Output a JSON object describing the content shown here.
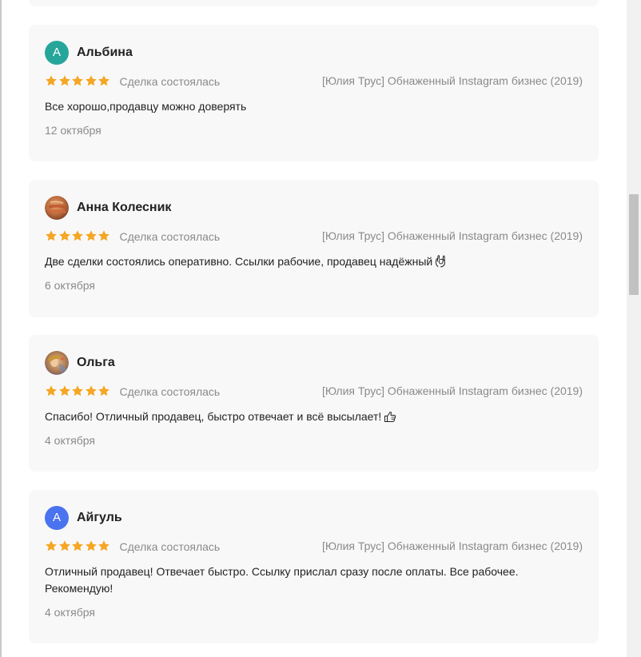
{
  "reviews": [
    {
      "author": "Альбина",
      "avatar_letter": "А",
      "avatar_color": "#26a69a",
      "avatar_type": "letter",
      "rating": 5,
      "deal_status": "Сделка состоялась",
      "product": "[Юлия Трус] Обнаженный Instagram бизнес (2019)",
      "text": "Все хорошо,продавцу можно доверять",
      "date": "12 октября"
    },
    {
      "author": "Анна Колесник",
      "avatar_type": "photo",
      "rating": 5,
      "deal_status": "Сделка состоялась",
      "product": "[Юлия Трус] Обнаженный Instagram бизнес (2019)",
      "text": "Две сделки состоялись оперативно. Ссылки рабочие, продавец надёжный",
      "text_icon": "ok-hand-icon",
      "date": "6 октября"
    },
    {
      "author": "Ольга",
      "avatar_type": "photo",
      "rating": 5,
      "deal_status": "Сделка состоялась",
      "product": "[Юлия Трус] Обнаженный Instagram бизнес (2019)",
      "text": "Спасибо! Отличный продавец, быстро отвечает и всё высылает!",
      "text_icon": "thumbs-up-icon",
      "date": "4 октября"
    },
    {
      "author": "Айгуль",
      "avatar_letter": "А",
      "avatar_color": "#4a73ef",
      "avatar_type": "letter",
      "rating": 5,
      "deal_status": "Сделка состоялась",
      "product": "[Юлия Трус] Обнаженный Instagram бизнес (2019)",
      "text": "Отличный продавец! Отвечает быстро. Ссылку прислал сразу после оплаты. Все рабочее. Рекомендую!",
      "date": "4 октября"
    }
  ],
  "colors": {
    "star": "#f5a623",
    "card_background": "#f8f8f8",
    "muted_text": "#8a8a8a"
  }
}
